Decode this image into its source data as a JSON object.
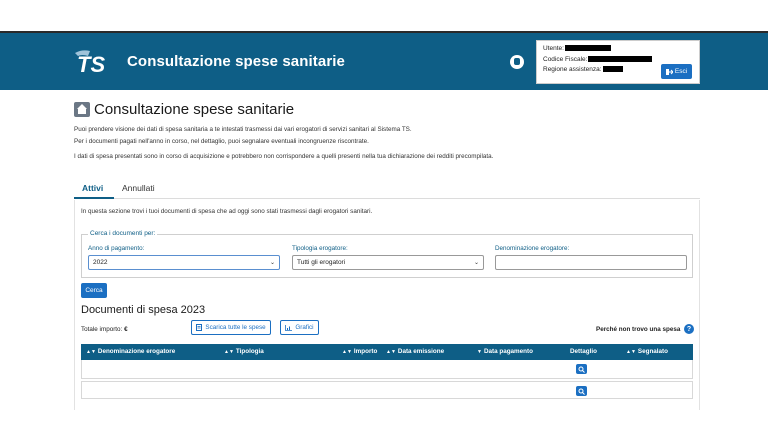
{
  "header": {
    "app_title": "Consultazione spese sanitarie",
    "logo_text": "TS",
    "user_label": "Utente:",
    "tax_code_label": "Codice Fiscale:",
    "region_label": "Regione assistenza:",
    "logout_label": "Esci"
  },
  "page": {
    "title": "Consultazione spese sanitarie",
    "intro_1": "Puoi prendere visione dei dati di spesa sanitaria a te intestati trasmessi dai vari erogatori di servizi sanitari al Sistema TS.",
    "intro_2": "Per i documenti pagati nell'anno in corso, nel dettaglio, puoi segnalare eventuali incongruenze riscontrate.",
    "intro_3": "I dati di spesa presentati sono in corso di acquisizione e potrebbero non corrispondere a quelli presenti nella tua dichiarazione dei redditi precompilata."
  },
  "tabs": [
    {
      "label": "Attivi",
      "active": true
    },
    {
      "label": "Annullati",
      "active": false
    }
  ],
  "panel": {
    "intro": "In questa sezione trovi i tuoi documenti di spesa che ad oggi sono stati trasmessi dagli erogatori sanitari."
  },
  "search": {
    "legend": "Cerca i documenti per:",
    "year_label": "Anno di pagamento:",
    "year_value": "2022",
    "type_label": "Tipologia erogatore:",
    "type_value": "Tutti gli erogatori",
    "name_label": "Denominazione erogatore:",
    "name_value": "",
    "button_label": "Cerca"
  },
  "documents": {
    "title": "Documenti di spesa 2023",
    "total_label": "Totale importo:",
    "total_value": "€",
    "download_label": "Scarica tutte le spese",
    "charts_label": "Grafici",
    "why_label": "Perché non trovo una spesa",
    "help_glyph": "?",
    "columns": [
      "Denominazione erogatore",
      "Tipologia",
      "Importo",
      "Data emissione",
      "Data pagamento",
      "Dettaglio",
      "Segnalato"
    ],
    "rows": 2
  },
  "colors": {
    "header_bg": "#0e5e86",
    "primary_button": "#1b6fc2"
  }
}
